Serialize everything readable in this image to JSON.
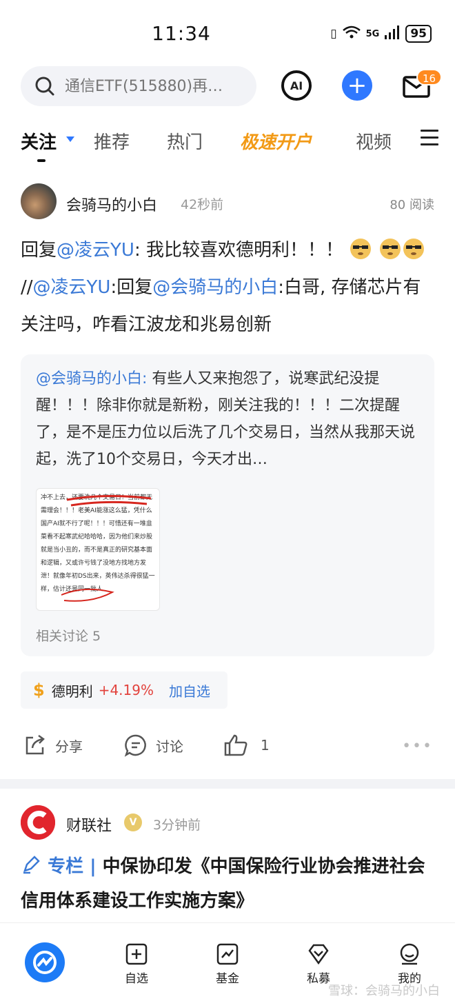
{
  "status_bar": {
    "time": "11:34",
    "network": "5G",
    "battery": "95"
  },
  "search": {
    "placeholder": "通信ETF(515880)再…"
  },
  "header": {
    "ai_label": "AI",
    "notification_count": "16"
  },
  "tabs": [
    {
      "label": "关注",
      "active": true
    },
    {
      "label": "推荐"
    },
    {
      "label": "热门"
    },
    {
      "label": "极速开户"
    },
    {
      "label": "视频"
    }
  ],
  "post1": {
    "username": "会骑马的小白",
    "time": "42秒前",
    "reads": "80 阅读",
    "text": {
      "p1": "回复",
      "m1": "@凌云YU",
      "p2": ": 我比较喜欢德明利！！！",
      "p3": "//",
      "m2": "@凌云YU",
      "p4": ":回复",
      "m3": "@会骑马的小白",
      "p5": ":白哥, 存储芯片有关注吗，咋看江波龙和兆易创新"
    },
    "quote": {
      "mention": "@会骑马的小白:",
      "text": " 有些人又来抱怨了，说寒武纪没提醒！！！除非你就是新粉，刚关注我的！！！二次提醒了，是不是压力位以后洗了几个交易日，当然从我那天说起，洗了10个交易日，今天才出…",
      "thumb_text": "冲不上去，还要洗几个交易日！当前都无需理会！！！老美AI能涨这么猛，凭什么国产AI就不行了呢！！！可惜还有一堆韭菜看不起寒武纪哈哈哈，因为他们来炒股就是当小丑的，而不是真正的研究基本面和逻辑，又或许亏钱了没地方找地方发泄！就像年初DS出来，英伟达杀得很猛一样，估计还是同一批人",
      "related": "相关讨论 5"
    },
    "stock": {
      "symbol": "$",
      "name": "德明利",
      "change": "+4.19%",
      "add_label": "加自选"
    },
    "actions": {
      "share": "分享",
      "comment": "讨论",
      "likes": "1"
    }
  },
  "post2": {
    "username": "财联社",
    "verified": "V",
    "time": "3分钟前",
    "column_tag": "专栏 | ",
    "title": "中保协印发《中国保险行业协会推进社会信用体系建设工作实施方案》"
  },
  "bottom_nav": {
    "items": [
      {
        "label": "自选"
      },
      {
        "label": "基金"
      },
      {
        "label": "私募"
      },
      {
        "label": "我的"
      }
    ],
    "watermark": "雪球：会骑马的小白"
  },
  "colors": {
    "accent": "#2f78ff",
    "link": "#3a79d6",
    "up": "#e2423c",
    "special_tab": "#f29a16"
  }
}
